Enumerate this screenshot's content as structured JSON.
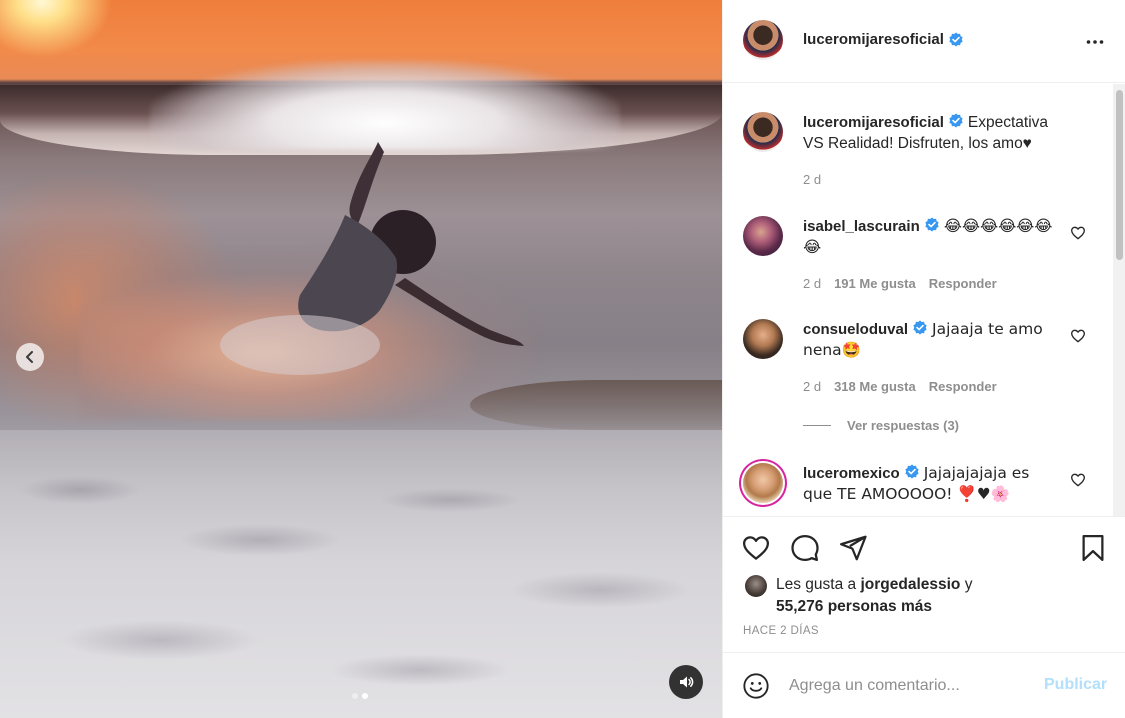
{
  "post": {
    "author": "luceromijaresoficial",
    "caption": "Expectativa VS Realidad! Disfruten, los amo♥",
    "caption_age": "2 d"
  },
  "media": {
    "current_slide": 2,
    "total_slides": 2
  },
  "comments": [
    {
      "username": "isabel_lascurain",
      "verified": true,
      "text": "😂😂😂😂😂😂😂",
      "age": "2 d",
      "likes": "191 Me gusta",
      "reply_label": "Responder"
    },
    {
      "username": "consueloduval",
      "verified": true,
      "text": "Jajaaja te amo nena🤩",
      "age": "2 d",
      "likes": "318 Me gusta",
      "reply_label": "Responder",
      "view_replies": "Ver respuestas (3)"
    },
    {
      "username": "luceromexico",
      "verified": true,
      "text": "Jajajajajaja es que TE AMOOOOO! ❣️♥🌸"
    }
  ],
  "actions": {
    "liked_by_prefix": "Les gusta a",
    "liked_by_user": "jorgedalessio",
    "liked_by_suffix": "y",
    "likes_count": "55,276 personas más",
    "timestamp": "HACE 2 DÍAS"
  },
  "composer": {
    "placeholder": "Agrega un comentario...",
    "publish_label": "Publicar"
  },
  "colors": {
    "verified": "#3897f0",
    "publish_disabled": "#b2dffc",
    "secondary_text": "#8e8e8e"
  },
  "icons": [
    "chevron-left-icon",
    "speaker-icon",
    "more-icon",
    "verified-icon",
    "heart-icon",
    "comment-icon",
    "share-icon",
    "bookmark-icon",
    "emoji-icon"
  ]
}
